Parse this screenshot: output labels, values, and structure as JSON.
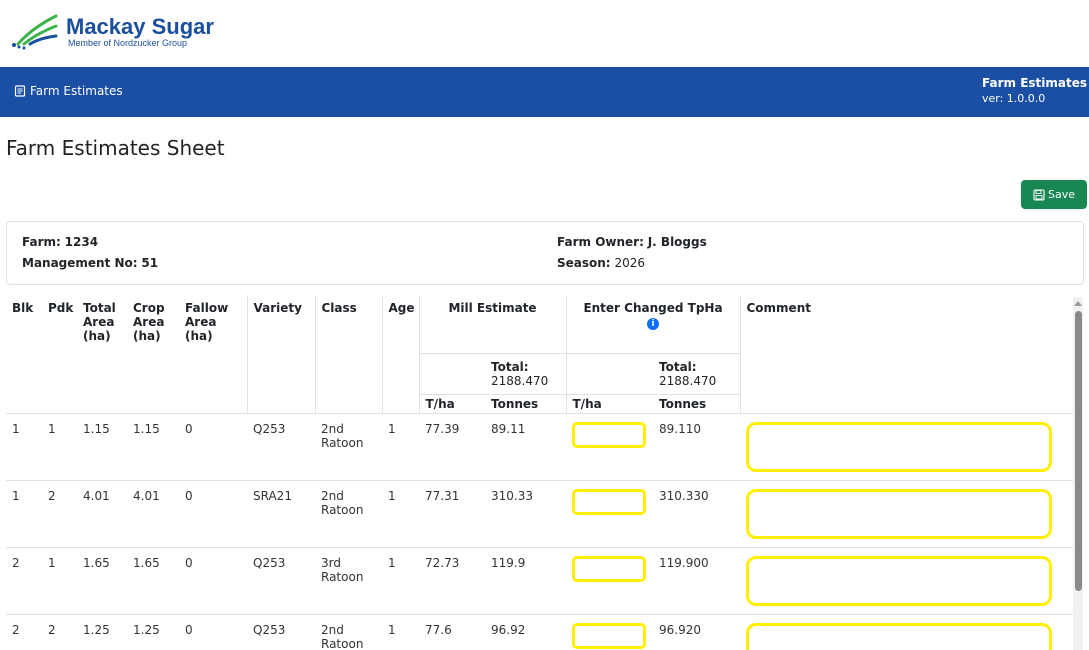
{
  "brand": {
    "name": "Mackay Sugar",
    "subtitle": "Member of Nordzucker Group",
    "color": "#1a4f9c",
    "logo_icon": "sugar-cane-leaves-icon"
  },
  "navbar": {
    "link_label": "Farm Estimates",
    "link_icon": "document-icon",
    "app_title": "Farm Estimates",
    "version": "ver: 1.0.0.0",
    "bg_color": "#1a4fa3"
  },
  "page": {
    "title": "Farm Estimates Sheet",
    "save_label": "Save",
    "save_color": "#198754"
  },
  "info": {
    "farm_label": "Farm:",
    "farm_value": "1234",
    "mgmt_label": "Management No:",
    "mgmt_value": "51",
    "owner_label": "Farm Owner:",
    "owner_value": "J. Bloggs",
    "season_label": "Season:",
    "season_value": "2026"
  },
  "table": {
    "headers": {
      "blk": "Blk",
      "pdk": "Pdk",
      "total_area": "Total Area (ha)",
      "crop_area": "Crop Area (ha)",
      "fallow_area": "Fallow Area (ha)",
      "variety": "Variety",
      "class": "Class",
      "age": "Age",
      "mill_estimate": "Mill Estimate",
      "enter_changed": "Enter Changed TpHa",
      "comment": "Comment",
      "total_label": "Total:",
      "mill_total": "2188.470",
      "changed_total": "2188.470",
      "tha": "T/ha",
      "tonnes": "Tonnes"
    },
    "rows": [
      {
        "blk": "1",
        "pdk": "1",
        "total_area": "1.15",
        "crop_area": "1.15",
        "fallow_area": "0",
        "variety": "Q253",
        "class": "2nd Ratoon",
        "age": "1",
        "tha": "77.39",
        "tonnes": "89.11",
        "changed_tonnes": "89.110"
      },
      {
        "blk": "1",
        "pdk": "2",
        "total_area": "4.01",
        "crop_area": "4.01",
        "fallow_area": "0",
        "variety": "SRA21",
        "class": "2nd Ratoon",
        "age": "1",
        "tha": "77.31",
        "tonnes": "310.33",
        "changed_tonnes": "310.330"
      },
      {
        "blk": "2",
        "pdk": "1",
        "total_area": "1.65",
        "crop_area": "1.65",
        "fallow_area": "0",
        "variety": "Q253",
        "class": "3rd Ratoon",
        "age": "1",
        "tha": "72.73",
        "tonnes": "119.9",
        "changed_tonnes": "119.900"
      },
      {
        "blk": "2",
        "pdk": "2",
        "total_area": "1.25",
        "crop_area": "1.25",
        "fallow_area": "0",
        "variety": "Q253",
        "class": "2nd Ratoon",
        "age": "1",
        "tha": "77.6",
        "tonnes": "96.92",
        "changed_tonnes": "96.920"
      }
    ],
    "highlight_color": "#ffef00"
  }
}
